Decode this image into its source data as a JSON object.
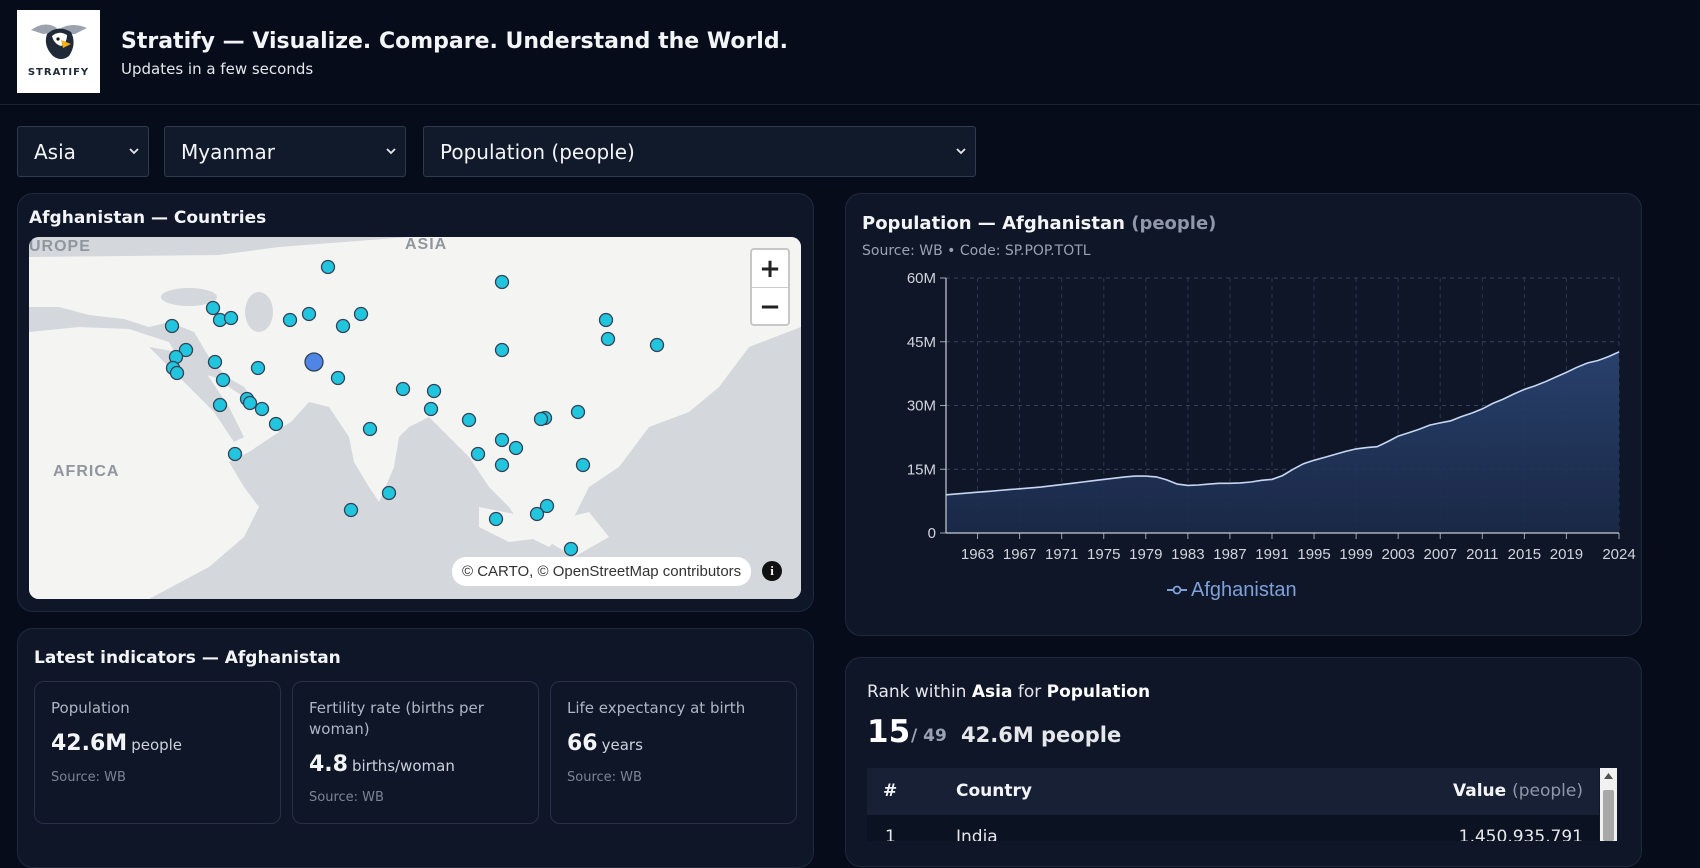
{
  "header": {
    "title": "Stratify — Visualize. Compare. Understand the World.",
    "subtitle": "Updates in a few seconds",
    "logo_text": "STRATIFY"
  },
  "filters": {
    "region": "Asia",
    "country": "Myanmar",
    "indicator": "Population (people)"
  },
  "map_card": {
    "title": "Afghanistan — Countries",
    "labels": {
      "europe": "UROPE",
      "asia": "ASIA",
      "africa": "AFRICA"
    },
    "zoom_in": "+",
    "zoom_out": "−",
    "attribution": "© CARTO, © OpenStreetMap contributors",
    "info": "i"
  },
  "indicators_card": {
    "title": "Latest indicators — Afghanistan",
    "items": [
      {
        "label": "Population",
        "value": "42.6M",
        "unit": "people",
        "source": "Source: WB"
      },
      {
        "label": "Fertility rate (births per woman)",
        "value": "4.8",
        "unit": "births/woman",
        "source": "Source: WB"
      },
      {
        "label": "Life expectancy at birth",
        "value": "66",
        "unit": "years",
        "source": "Source: WB"
      }
    ]
  },
  "chart_card": {
    "title_prefix": "Population — Afghanistan",
    "title_unit": "(people)",
    "source": "Source: WB • Code: SP.POP.TOTL",
    "legend": "Afghanistan",
    "line_color": "#c7d6f2",
    "fill_color": "#2a4370"
  },
  "chart_data": {
    "type": "area",
    "title": "Population — Afghanistan (people)",
    "xlabel": "",
    "ylabel": "",
    "x": [
      1960,
      1961,
      1962,
      1963,
      1964,
      1965,
      1966,
      1967,
      1968,
      1969,
      1970,
      1971,
      1972,
      1973,
      1974,
      1975,
      1976,
      1977,
      1978,
      1979,
      1980,
      1981,
      1982,
      1983,
      1984,
      1985,
      1986,
      1987,
      1988,
      1989,
      1990,
      1991,
      1992,
      1993,
      1994,
      1995,
      1996,
      1997,
      1998,
      1999,
      2000,
      2001,
      2002,
      2003,
      2004,
      2005,
      2006,
      2007,
      2008,
      2009,
      2010,
      2011,
      2012,
      2013,
      2014,
      2015,
      2016,
      2017,
      2018,
      2019,
      2020,
      2021,
      2022,
      2023,
      2024
    ],
    "series": [
      {
        "name": "Afghanistan",
        "values": [
          9.0,
          9.2,
          9.4,
          9.6,
          9.8,
          10.0,
          10.2,
          10.4,
          10.6,
          10.8,
          11.1,
          11.4,
          11.7,
          12.0,
          12.3,
          12.6,
          12.9,
          13.2,
          13.4,
          13.4,
          13.2,
          12.5,
          11.5,
          11.2,
          11.3,
          11.5,
          11.7,
          11.7,
          11.8,
          12.0,
          12.4,
          12.6,
          13.5,
          15.0,
          16.3,
          17.1,
          17.8,
          18.5,
          19.2,
          19.8,
          20.1,
          20.3,
          21.5,
          22.8,
          23.6,
          24.4,
          25.4,
          25.9,
          26.4,
          27.4,
          28.2,
          29.2,
          30.5,
          31.5,
          32.7,
          33.8,
          34.6,
          35.6,
          36.7,
          37.8,
          39.0,
          40.0,
          40.6,
          41.5,
          42.6
        ]
      }
    ],
    "value_unit": "millions",
    "ylim": [
      0,
      60
    ],
    "y_ticks": [
      "0",
      "15M",
      "30M",
      "45M",
      "60M"
    ],
    "x_ticks": [
      "1963",
      "1967",
      "1971",
      "1975",
      "1979",
      "1983",
      "1987",
      "1991",
      "1995",
      "1999",
      "2003",
      "2007",
      "2011",
      "2015",
      "2019",
      "2024"
    ],
    "grid": true,
    "legend": "bottom-center"
  },
  "rank_card": {
    "prefix": "Rank within",
    "region": "Asia",
    "middle": "for",
    "indicator": "Population",
    "rank": "15",
    "of": "/ 49",
    "value": "42.6M people",
    "table": {
      "col_rank": "#",
      "col_country": "Country",
      "col_value": "Value",
      "col_unit": "(people)",
      "rows": [
        {
          "rank": "1",
          "country": "India",
          "value": "1,450,935,791"
        }
      ]
    }
  }
}
